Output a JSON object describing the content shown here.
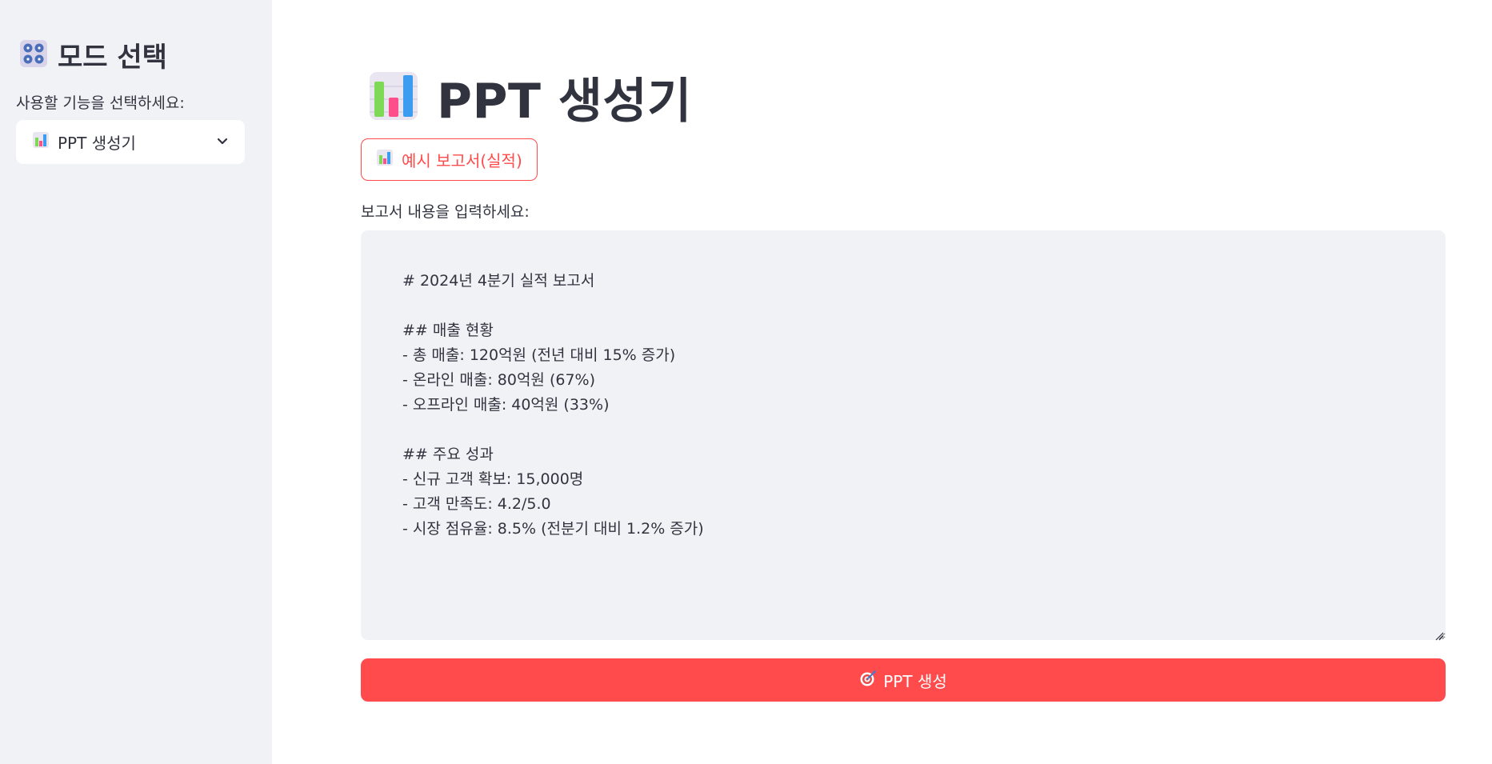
{
  "sidebar": {
    "title": "모드 선택",
    "title_icon": "control-knobs-icon",
    "select_label": "사용할 기능을 선택하세요:",
    "select_value": "PPT 생성기",
    "select_icon": "bar-chart-icon"
  },
  "main": {
    "title": "PPT 생성기",
    "title_icon": "bar-chart-icon",
    "example_button_label": "예시 보고서(실적)",
    "textarea_label": "보고서 내용을 입력하세요:",
    "textarea_value": "# 2024년 4분기 실적 보고서\n\n## 매출 현황\n- 총 매출: 120억원 (전년 대비 15% 증가)\n- 온라인 매출: 80억원 (67%)\n- 오프라인 매출: 40억원 (33%)\n\n## 주요 성과\n- 신규 고객 확보: 15,000명\n- 고객 만족도: 4.2/5.0\n- 시장 점유율: 8.5% (전분기 대비 1.2% 증가)",
    "generate_button_label": "PPT 생성",
    "generate_icon": "dart-target-icon"
  },
  "colors": {
    "accent": "#ff4b4b",
    "sidebar_bg": "#f0f2f6",
    "text": "#31333f"
  }
}
